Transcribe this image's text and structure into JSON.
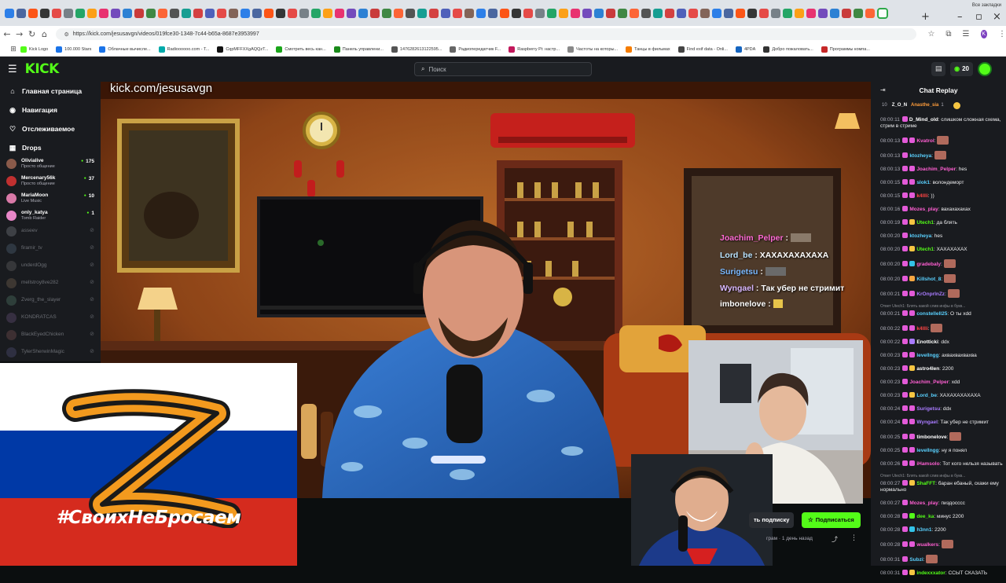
{
  "browser": {
    "url": "https://kick.com/jesusavgn/videos/019fce30-1348-7c44-b65a-8687e3953997",
    "bookmarks": [
      "Kick Logo",
      "100.000 Stars",
      "Облачные вычисле...",
      "Radioooooo.com - T...",
      "CqpMFFXXgAQQzT...",
      "Смотреть весь кан...",
      "Панель управлени...",
      "1476282613122595...",
      "Радиопередатчик F...",
      "Raspberry Pi: настр...",
      "Частоты на которы...",
      "Танцы в фильмах",
      "Find exif data - Onli...",
      "4PDA",
      "Добро пожаловать...",
      "Программы компа..."
    ],
    "all_bookmarks": "Все закладки",
    "profile_letter": "K"
  },
  "kick": {
    "logo": "KICK",
    "search_placeholder": "Поиск",
    "coins": "20"
  },
  "sidebar": {
    "nav": [
      {
        "label": "Главная страница",
        "icon": "home-icon"
      },
      {
        "label": "Навигация",
        "icon": "compass-icon"
      },
      {
        "label": "Отслеживаемое",
        "icon": "heart-icon"
      },
      {
        "label": "Drops",
        "icon": "drops-icon"
      }
    ],
    "live_channels": [
      {
        "name": "Olivialive",
        "category": "Просто общение",
        "viewers": "175",
        "color": "#8a5a4a"
      },
      {
        "name": "Mercenary56k",
        "category": "Просто общение",
        "viewers": "37",
        "color": "#c03030"
      },
      {
        "name": "MariaMoon",
        "category": "Live Music",
        "viewers": "10",
        "color": "#d97aa8"
      },
      {
        "name": "only_katya",
        "category": "Tomb Raider",
        "viewers": "1",
        "color": "#e887c8"
      }
    ],
    "offline_channels": [
      "asseev",
      "firamir_tv",
      "underdOgg",
      "mellstroy8ve282",
      "Zverg_the_slayer",
      "KONDRATCAS",
      "BlackEyedChicken",
      "TylerSherwinMagic"
    ]
  },
  "video": {
    "watermark": "kick.com/jesusavgn",
    "overlay_chat": [
      {
        "user": "Joachim_Pelper",
        "text": ""
      },
      {
        "user": "Lord_be",
        "text": "ХАХАХАХАХАХА"
      },
      {
        "user": "Surigetsu",
        "text": ""
      },
      {
        "user": "Wyngael",
        "text": "Так убер не стримит"
      },
      {
        "user": "imbonelove",
        "text": ""
      }
    ],
    "banner_hashtag": "#СвоихНеБросаем",
    "sub_button_partial": "ть подписку",
    "subscribe_button": "Подписаться",
    "meta_text": "грам · 1 день назад"
  },
  "chat": {
    "title": "Chat Replay",
    "pinned": {
      "count": "10",
      "user1": "Z_O_N",
      "user2": "Anasthe_sia",
      "num": "1"
    },
    "messages": [
      {
        "time": "08:00:11",
        "user": "D_Mind_old",
        "color": "#ffffff",
        "text": "слишком сложная схема, стрим в стриме",
        "badge": ""
      },
      {
        "time": "08:00:13",
        "user": "Kvatrol",
        "color": "#ff5fd2",
        "text": "",
        "badge": "#e35ad8",
        "emote": true
      },
      {
        "time": "08:00:13",
        "user": "ktozheya",
        "color": "#5ad1ff",
        "text": "",
        "badge": "",
        "emote": true
      },
      {
        "time": "08:00:13",
        "user": "Joachim_Pelper",
        "color": "#ff5fd2",
        "text": "hes",
        "badge": "#e35ad8"
      },
      {
        "time": "08:00:15",
        "user": "slok1",
        "color": "#5ad1ff",
        "text": "волондеморт",
        "badge": "#e35ad8"
      },
      {
        "time": "08:00:15",
        "user": "k4llli",
        "color": "#ff4444",
        "text": "))",
        "badge": "#e35ad8"
      },
      {
        "time": "08:00:16",
        "user": "Mozes_play",
        "color": "#ff5fd2",
        "text": "вахахахахах",
        "badge": ""
      },
      {
        "time": "08:00:19",
        "user": "Utech1",
        "color": "#53fc18",
        "text": "да блять",
        "badge": "#f5c542"
      },
      {
        "time": "08:00:20",
        "user": "ktozheya",
        "color": "#5ad1ff",
        "text": "hes",
        "badge": ""
      },
      {
        "time": "08:00:20",
        "user": "Utech1",
        "color": "#53fc18",
        "text": "ХАХАХАХАХ",
        "badge": "#f5c542"
      },
      {
        "time": "08:00:20",
        "user": "gradebaly",
        "color": "#ff5fd2",
        "text": "",
        "badge": "#33c3e8",
        "emote": true
      },
      {
        "time": "08:00:20",
        "user": "Killshot_8",
        "color": "#5ad1ff",
        "text": "",
        "badge": "#f5a742",
        "emote": true
      },
      {
        "time": "08:00:21",
        "user": "KrOnprInZz",
        "color": "#a97bff",
        "text": "",
        "badge": "#e35ad8",
        "emote": true
      },
      {
        "time": "08:00:21",
        "user": "constellell25",
        "color": "#5ad1ff",
        "text": "О ты xdd",
        "badge": "#e35ad8",
        "reply": "Ответ Utech1: Блять какой слив инфы в букв..."
      },
      {
        "time": "08:00:22",
        "user": "k4llli",
        "color": "#ff4444",
        "text": "",
        "badge": "#e35ad8",
        "emote": true
      },
      {
        "time": "08:00:22",
        "user": "Enotticki",
        "color": "#ffffff",
        "text": "ddx",
        "badge": "#a97bff"
      },
      {
        "time": "08:00:23",
        "user": "levelIngg",
        "color": "#5ad1ff",
        "text": "ахвахвахвахва",
        "badge": "#e35ad8"
      },
      {
        "time": "08:00:23",
        "user": "astro4len",
        "color": "#ffffff",
        "text": "2200",
        "badge": "#f5c542"
      },
      {
        "time": "08:00:23",
        "user": "Joachim_Pelper",
        "color": "#ff5fd2",
        "text": "xdd",
        "badge": ""
      },
      {
        "time": "08:00:23",
        "user": "Lord_be",
        "color": "#5ad1ff",
        "text": "ХАХАХАХАХАХА",
        "badge": "#f5c542"
      },
      {
        "time": "08:00:24",
        "user": "Surigetsu",
        "color": "#a97bff",
        "text": "ddx",
        "badge": "#e35ad8"
      },
      {
        "time": "08:00:24",
        "user": "Wyngael",
        "color": "#a97bff",
        "text": "Так убер не стримит",
        "badge": "#e35ad8"
      },
      {
        "time": "08:00:25",
        "user": "timbonelove",
        "color": "#ffffff",
        "text": "",
        "badge": "#e35ad8",
        "emote": true
      },
      {
        "time": "08:00:25",
        "user": "levelIngg",
        "color": "#5ad1ff",
        "text": "ну я понял",
        "badge": "#e35ad8"
      },
      {
        "time": "08:00:26",
        "user": "iHamsolo",
        "color": "#ff5fd2",
        "text": "Тот кого нельзя называть",
        "badge": "#e35ad8"
      },
      {
        "time": "08:00:27",
        "user": "ShaFFT",
        "color": "#53fc18",
        "text": "баран ебаный, скажи ему нормально",
        "badge": "#f5c542",
        "reply": "Ответ Utech1: Блять какой слив инфы в букв..."
      },
      {
        "time": "08:00:27",
        "user": "Mozes_play",
        "color": "#ff5fd2",
        "text": "пиздосссс",
        "badge": ""
      },
      {
        "time": "08:00:28",
        "user": "dee_ka",
        "color": "#53fc18",
        "text": "минус 2200",
        "badge": "#53fc18"
      },
      {
        "time": "08:00:28",
        "user": "h3nn1",
        "color": "#5ad1ff",
        "text": "2200",
        "badge": "#33c3e8"
      },
      {
        "time": "08:00:28",
        "user": "wualkers",
        "color": "#ff5fd2",
        "text": "",
        "badge": "#e35ad8",
        "emote": true
      },
      {
        "time": "08:00:31",
        "user": "Subzi",
        "color": "#5ad1ff",
        "text": "",
        "badge": "",
        "emote": true
      },
      {
        "time": "08:00:31",
        "user": "indexxxator",
        "color": "#53fc18",
        "text": "ССЫТ СКАЗАТЬ",
        "badge": "#f5c542"
      }
    ]
  }
}
